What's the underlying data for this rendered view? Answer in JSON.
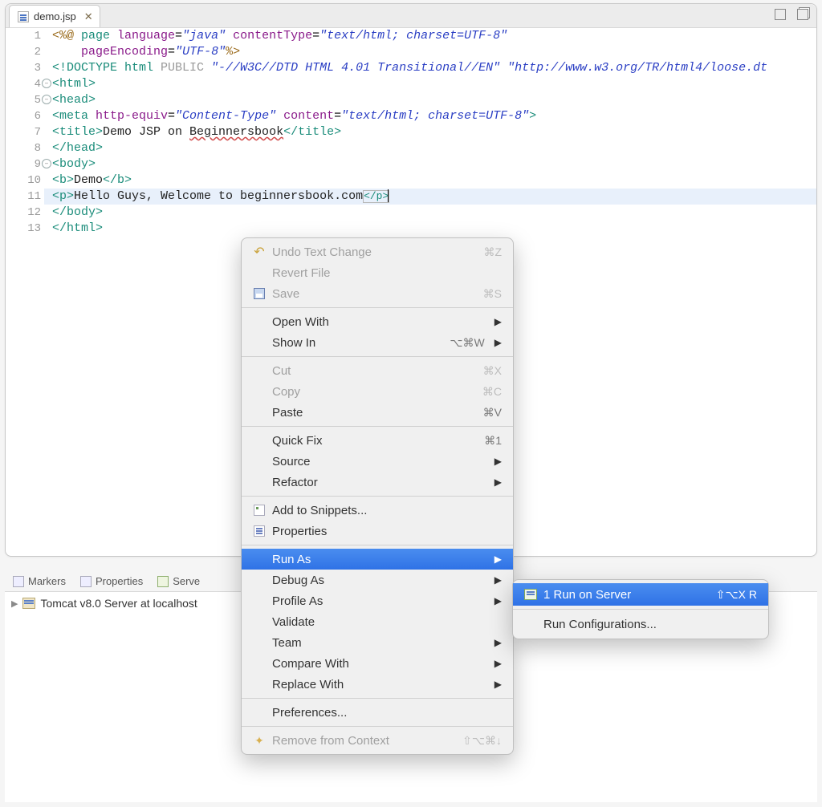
{
  "editor": {
    "tab": {
      "filename": "demo.jsp"
    },
    "lines": {
      "l1_a": "<%@",
      "l1_b": " page ",
      "l1_c": "language",
      "l1_d": "=",
      "l1_e": "\"java\"",
      "l1_f": " contentType",
      "l1_g": "=",
      "l1_h": "\"text/html; charset=UTF-8\"",
      "l2_a": "    ",
      "l2_b": "pageEncoding",
      "l2_c": "=",
      "l2_d": "\"UTF-8\"",
      "l2_e": "%>",
      "l3_a": "<!DOCTYPE ",
      "l3_b": "html ",
      "l3_c": "PUBLIC ",
      "l3_d": "\"-//W3C//DTD HTML 4.01 Transitional//EN\"",
      "l3_e": " ",
      "l3_f": "\"http://www.w3.org/TR/html4/loose.dt",
      "l4": "<html>",
      "l5": "<head>",
      "l6_a": "<meta ",
      "l6_b": "http-equiv",
      "l6_c": "=",
      "l6_d": "\"Content-Type\"",
      "l6_e": " content",
      "l6_f": "=",
      "l6_g": "\"text/html; charset=UTF-8\"",
      "l6_h": ">",
      "l7_a": "<title>",
      "l7_b": "Demo JSP on ",
      "l7_c": "Beginnersbook",
      "l7_d": "</title>",
      "l8": "</head>",
      "l9": "<body>",
      "l10_a": "<b>",
      "l10_b": "Demo",
      "l10_c": "</b>",
      "l11_a": "<p>",
      "l11_b": "Hello Guys, Welcome to beginnersbook.com",
      "l11_c": "</p>",
      "l12": "</body>",
      "l13": "</html>"
    },
    "line_numbers": [
      "1",
      "2",
      "3",
      "4",
      "5",
      "6",
      "7",
      "8",
      "9",
      "10",
      "11",
      "12",
      "13"
    ]
  },
  "bottom_tabs": {
    "markers": "Markers",
    "properties": "Properties",
    "servers": "Serve"
  },
  "server_row": "Tomcat v8.0 Server at localhost",
  "context_menu": {
    "undo": "Undo Text Change",
    "undo_sc": "⌘Z",
    "revert": "Revert File",
    "save": "Save",
    "save_sc": "⌘S",
    "open_with": "Open With",
    "show_in": "Show In",
    "show_in_sc": "⌥⌘W",
    "cut": "Cut",
    "cut_sc": "⌘X",
    "copy": "Copy",
    "copy_sc": "⌘C",
    "paste": "Paste",
    "paste_sc": "⌘V",
    "quick_fix": "Quick Fix",
    "quick_fix_sc": "⌘1",
    "source": "Source",
    "refactor": "Refactor",
    "add_snip": "Add to Snippets...",
    "properties": "Properties",
    "run_as": "Run As",
    "debug_as": "Debug As",
    "profile_as": "Profile As",
    "validate": "Validate",
    "team": "Team",
    "compare_with": "Compare With",
    "replace_with": "Replace With",
    "preferences": "Preferences...",
    "remove_ctx": "Remove from Context",
    "remove_ctx_sc": "⇧⌥⌘↓"
  },
  "submenu": {
    "run_on_server": "1 Run on Server",
    "run_sc": "⇧⌥X R",
    "run_config": "Run Configurations..."
  }
}
